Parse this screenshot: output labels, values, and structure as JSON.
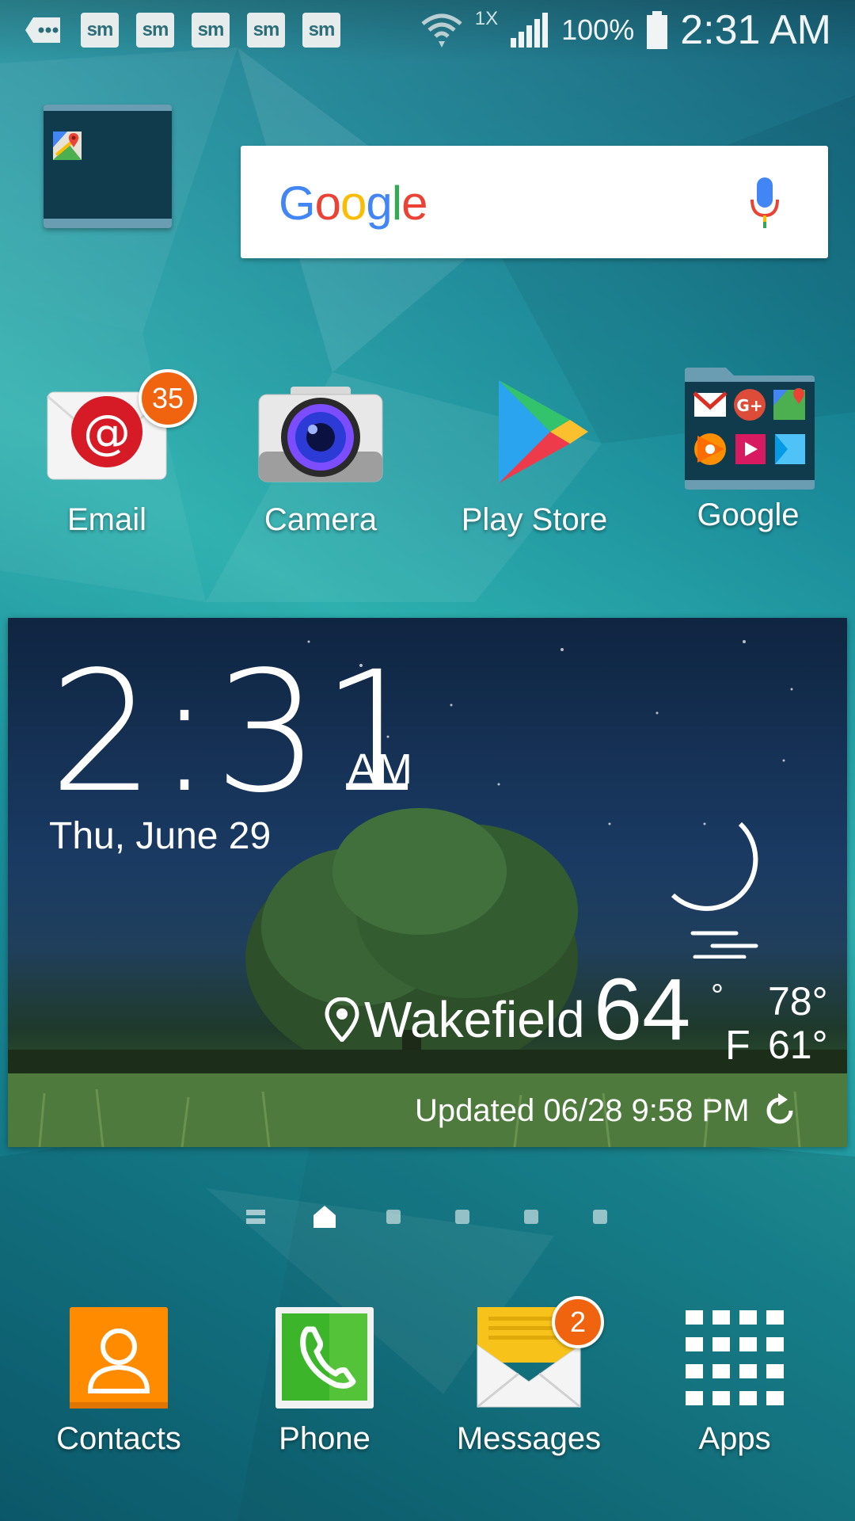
{
  "status_bar": {
    "notification_icons": [
      "sm",
      "sm",
      "sm",
      "sm",
      "sm"
    ],
    "network_label": "1X",
    "battery": "100%",
    "time": "2:31 AM"
  },
  "search": {
    "logo_letters": [
      "G",
      "o",
      "o",
      "g",
      "l",
      "e"
    ],
    "mic_icon": "mic-icon"
  },
  "apps": {
    "email": {
      "label": "Email",
      "badge": "35"
    },
    "camera": {
      "label": "Camera"
    },
    "play_store": {
      "label": "Play Store"
    },
    "google_folder": {
      "label": "Google"
    }
  },
  "widget": {
    "time": "2:31",
    "ampm": "AM",
    "date": "Thu, June 29",
    "location": "Wakefield",
    "temperature": "64",
    "degree_symbol": "°",
    "unit": "F",
    "high": "78°",
    "low": "61°",
    "updated": "Updated 06/28 9:58 PM",
    "condition_icon": "moon-haze-icon"
  },
  "pager": {
    "pages": 6,
    "active_index": 1
  },
  "dock": {
    "contacts": {
      "label": "Contacts"
    },
    "phone": {
      "label": "Phone"
    },
    "messages": {
      "label": "Messages",
      "badge": "2"
    },
    "apps": {
      "label": "Apps"
    }
  },
  "colors": {
    "badge": "#f0640f",
    "contacts": "#ff8c00",
    "phone": "#3cb52b",
    "messages_flap": "#f7c21a"
  }
}
